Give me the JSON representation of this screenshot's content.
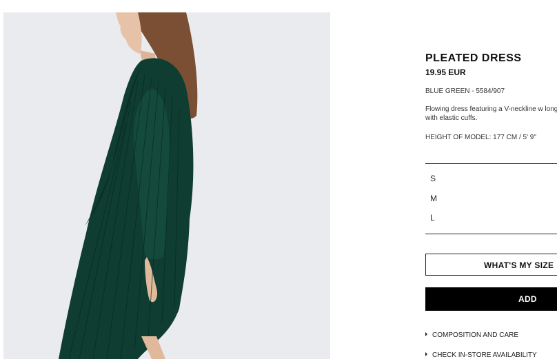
{
  "product": {
    "name": "PLEATED DRESS",
    "price": "19.95 EUR",
    "color_ref": "BLUE GREEN - 5584/907",
    "description": "Flowing dress featuring a V-neckline w long sleeves with elastic cuffs.",
    "model_height": "HEIGHT OF MODEL: 177 CM / 5' 9\""
  },
  "sizes": [
    "S",
    "M",
    "L"
  ],
  "buttons": {
    "whats_my_size": "WHAT'S MY SIZE",
    "add": "ADD"
  },
  "links": {
    "composition": "COMPOSITION AND CARE",
    "store": "CHECK IN-STORE AVAILABILITY"
  },
  "colors": {
    "dress": "#0f3d31",
    "background": "#e9ebef",
    "button_bg": "#000000"
  },
  "icons": {
    "link_marker": "triangle-right-icon"
  }
}
